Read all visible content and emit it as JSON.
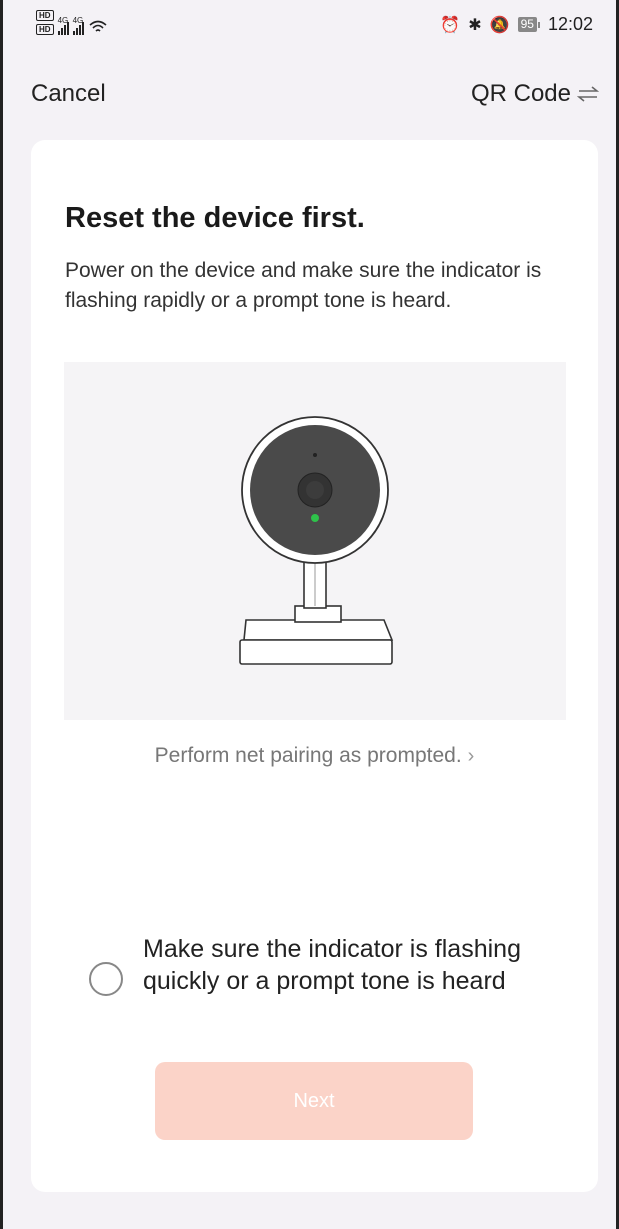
{
  "status_bar": {
    "hd_label": "HD",
    "network_label": "4G",
    "battery": "95",
    "time": "12:02"
  },
  "nav": {
    "cancel": "Cancel",
    "qr_code": "QR Code"
  },
  "content": {
    "title": "Reset the device first.",
    "description": "Power on the device and make sure the indicator is flashing rapidly or a prompt tone is heard.",
    "pairing_link": "Perform net pairing as prompted.",
    "confirm_label": "Make sure the indicator is flashing quickly or a prompt tone is heard",
    "confirm_checked": false,
    "next_button": "Next"
  },
  "colors": {
    "next_button_bg": "#fbd3c8",
    "indicator_led": "#2ec24a"
  }
}
